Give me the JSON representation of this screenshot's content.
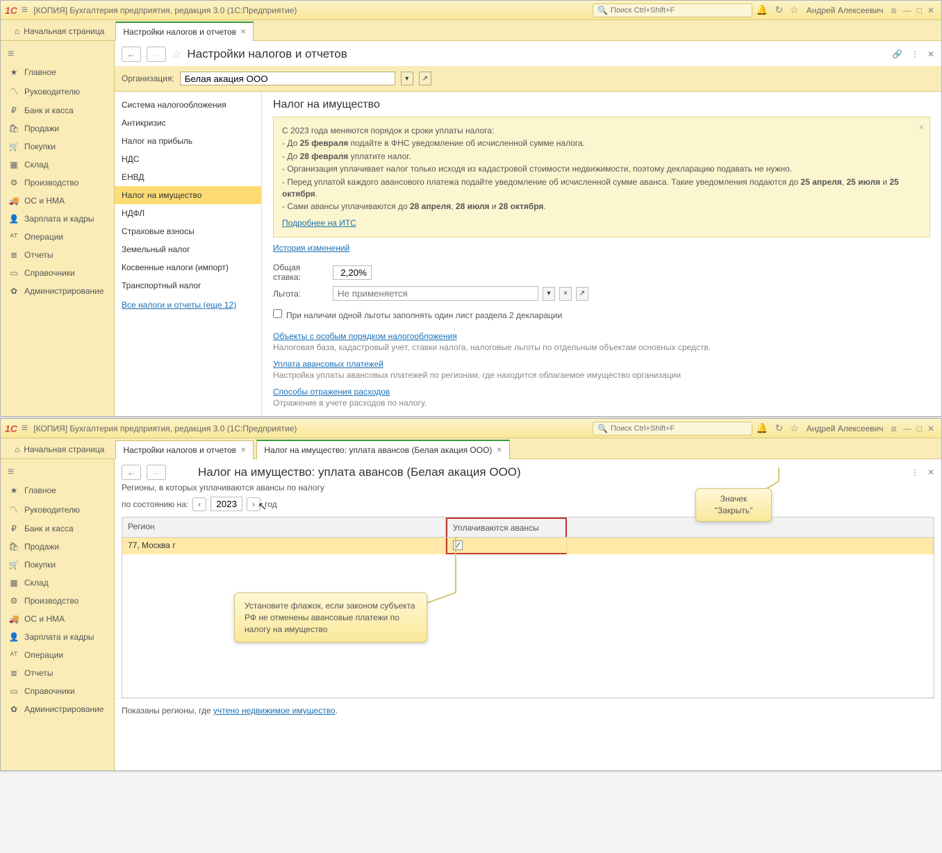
{
  "app": {
    "title": "[КОПИЯ] Бухгалтерия предприятия, редакция 3.0  (1С:Предприятие)",
    "search_placeholder": "Поиск Ctrl+Shift+F",
    "user": "Андрей Алексеевич"
  },
  "tabs": {
    "home": "Начальная страница",
    "t1": "Настройки налогов и отчетов",
    "t2": "Налог на имущество: уплата авансов (Белая акация ООО)"
  },
  "sidebar": [
    {
      "icon": "★",
      "label": "Главное"
    },
    {
      "icon": "〽",
      "label": "Руководителю"
    },
    {
      "icon": "₽",
      "label": "Банк и касса"
    },
    {
      "icon": "🛍",
      "label": "Продажи"
    },
    {
      "icon": "🛒",
      "label": "Покупки"
    },
    {
      "icon": "▦",
      "label": "Склад"
    },
    {
      "icon": "⚙",
      "label": "Производство"
    },
    {
      "icon": "🚚",
      "label": "ОС и НМА"
    },
    {
      "icon": "👤",
      "label": "Зарплата и кадры"
    },
    {
      "icon": "ᴬᵀ",
      "label": "Операции"
    },
    {
      "icon": "≣",
      "label": "Отчеты"
    },
    {
      "icon": "▭",
      "label": "Справочники"
    },
    {
      "icon": "✿",
      "label": "Администрирование"
    }
  ],
  "page1": {
    "title": "Настройки налогов и отчетов",
    "org_label": "Организация:",
    "org_value": "Белая акация ООО",
    "nav": [
      "Система налогообложения",
      "Антикризис",
      "Налог на прибыль",
      "НДС",
      "ЕНВД",
      "Налог на имущество",
      "НДФЛ",
      "Страховые взносы",
      "Земельный налог",
      "Косвенные налоги (импорт)",
      "Транспортный налог"
    ],
    "nav_link": "Все налоги и отчеты (еще 12)",
    "detail_title": "Налог на имущество",
    "info": {
      "l1": "С 2023 года меняются порядок и сроки уплаты налога:",
      "l2a": " - До ",
      "l2b": "25 февраля",
      "l2c": " подайте в ФНС уведомление об исчисленной сумме налога.",
      "l3a": " - До ",
      "l3b": "28 февраля",
      "l3c": " уплатите налог.",
      "l4": " - Организация уплачивает налог только исходя из кадастровой стоимости недвижимости, поэтому декларацию подавать не нужно.",
      "l5": " - Перед уплатой каждого авансового платежа подайте уведомление об исчисленной сумме аванса. Такие уведомления подаются до ",
      "l5b": "25 апреля",
      "l5c": ", ",
      "l5d": "25 июля",
      "l5e": " и ",
      "l5f": "25 октября",
      "l5g": ".",
      "l6a": " - Сами авансы уплачиваются до ",
      "l6b": "28 апреля",
      "l6c": ", ",
      "l6d": "28 июля",
      "l6e": " и ",
      "l6f": "28 октября",
      "l6g": ".",
      "link_its": "Подробнее на ИТС"
    },
    "history_link": "История изменений",
    "rate_label": "Общая ставка:",
    "rate_value": "2,20%",
    "lgota_label": "Льгота:",
    "lgota_placeholder": "Не применяется",
    "chk_label": "При наличии одной льготы заполнять один лист раздела 2 декларации",
    "sect1_link": "Объекты с особым порядком налогообложения",
    "sect1_hint": "Налоговая база, кадастровый учет, ставки налога, налоговые льготы по отдельным объектам основных средств.",
    "sect2_link": "Уплата авансовых платежей",
    "sect2_hint": "Настройка уплаты авансовых платежей по регионам, где находится облагаемое имущество организации",
    "sect3_link": "Способы отражения расходов",
    "sect3_hint": "Отражение в учете расходов по налогу."
  },
  "page2": {
    "title": "Налог на имущество: уплата авансов (Белая акация ООО)",
    "desc": "Регионы, в которых уплачиваются авансы по налогу",
    "asof": "по состоянию на:",
    "year": "2023",
    "year_suffix": "год",
    "col_region": "Регион",
    "col_pay": "Уплачиваются авансы",
    "row_region": "77, Москва г",
    "callout_main": "Установите флажок, если законом субъекта РФ не отменены авансовые платежи по налогу на имущество",
    "callout_close": "Значек \"Закрыть\"",
    "footer_a": "Показаны регионы, где ",
    "footer_link": "учтено недвижимое имущество",
    "footer_b": "."
  }
}
